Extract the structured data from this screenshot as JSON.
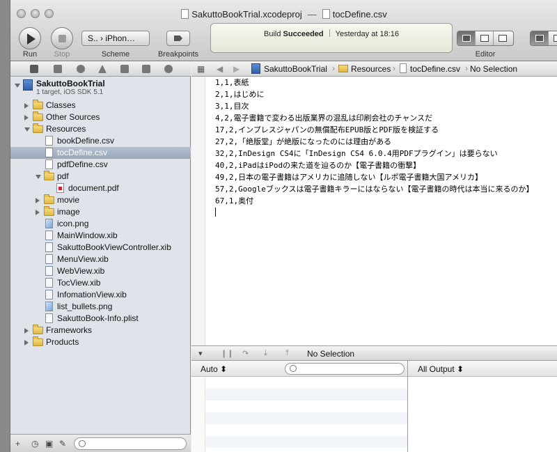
{
  "window": {
    "title_project": "SakuttoBookTrial.xcodeproj",
    "title_separator": "—",
    "title_file": "tocDefine.csv"
  },
  "toolbar": {
    "run_label": "Run",
    "stop_label": "Stop",
    "scheme_value": "S.. › iPhon…",
    "scheme_label": "Scheme",
    "breakpoints_label": "Breakpoints",
    "editor_label": "Editor"
  },
  "status": {
    "prefix": "Build",
    "result": "Succeeded",
    "time": "Yesterday at 18:16"
  },
  "project": {
    "name": "SakuttoBookTrial",
    "subtitle": "1 target, iOS SDK 5.1"
  },
  "tree": [
    {
      "label": "Classes",
      "type": "folder",
      "depth": 1,
      "expanded": false
    },
    {
      "label": "Other Sources",
      "type": "folder",
      "depth": 1,
      "expanded": false
    },
    {
      "label": "Resources",
      "type": "folder",
      "depth": 1,
      "expanded": true
    },
    {
      "label": "bookDefine.csv",
      "type": "file",
      "depth": 2
    },
    {
      "label": "tocDefine.csv",
      "type": "file",
      "depth": 2,
      "selected": true
    },
    {
      "label": "pdfDefine.csv",
      "type": "file",
      "depth": 2
    },
    {
      "label": "pdf",
      "type": "folder",
      "depth": 2,
      "expanded": true
    },
    {
      "label": "document.pdf",
      "type": "pdf",
      "depth": 3
    },
    {
      "label": "movie",
      "type": "folder",
      "depth": 2,
      "expanded": false
    },
    {
      "label": "image",
      "type": "folder",
      "depth": 2,
      "expanded": false
    },
    {
      "label": "icon.png",
      "type": "img",
      "depth": 2
    },
    {
      "label": "MainWindow.xib",
      "type": "xib",
      "depth": 2
    },
    {
      "label": "SakuttoBookViewController.xib",
      "type": "xib",
      "depth": 2
    },
    {
      "label": "MenuView.xib",
      "type": "xib",
      "depth": 2
    },
    {
      "label": "WebView.xib",
      "type": "xib",
      "depth": 2
    },
    {
      "label": "TocView.xib",
      "type": "xib",
      "depth": 2
    },
    {
      "label": "InfomationView.xib",
      "type": "xib",
      "depth": 2
    },
    {
      "label": "list_bullets.png",
      "type": "img",
      "depth": 2
    },
    {
      "label": "SakuttoBook-Info.plist",
      "type": "file",
      "depth": 2
    },
    {
      "label": "Frameworks",
      "type": "folder",
      "depth": 1,
      "expanded": false
    },
    {
      "label": "Products",
      "type": "folder",
      "depth": 1,
      "expanded": false
    }
  ],
  "jumpbar": {
    "project": "SakuttoBookTrial",
    "group": "Resources",
    "file": "tocDefine.csv",
    "selection": "No Selection"
  },
  "code_lines": [
    "1,1,表紙",
    "2,1,はじめに",
    "3,1,目次",
    "4,2,電子書籍で変わる出版業界の混乱は印刷会社のチャンスだ",
    "17,2,インプレスジャパンの無償配布EPUB版とPDF版を検証する",
    "27,2,「絶版堂」が絶版になったのには理由がある",
    "32,2,InDesign CS4に「InDesign CS4 6.0.4用PDFプラグイン」は要らない",
    "40,2,iPadはiPodの来た道を辿るのか【電子書籍の衝撃】",
    "49,2,日本の電子書籍はアメリカに追随しない【ルポ電子書籍大国アメリカ】",
    "57,2,Googleブックスは電子書籍キラーにはならない【電子書籍の時代は本当に来るのか】",
    "67,1,奥付"
  ],
  "debug": {
    "selection": "No Selection",
    "variables_scope": "Auto ⬍",
    "console_scope": "All Output ⬍"
  }
}
